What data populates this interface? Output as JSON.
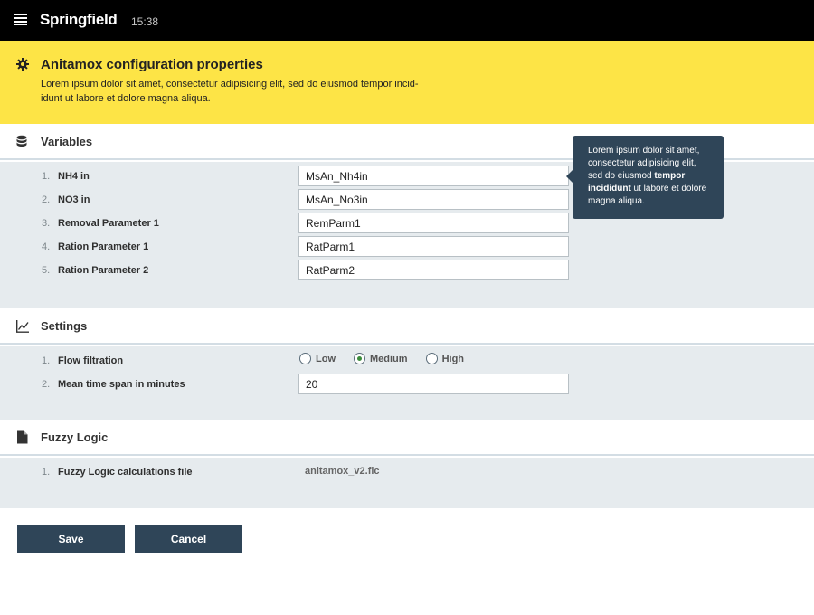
{
  "app": {
    "name": "Springfield",
    "time": "15:38"
  },
  "banner": {
    "title": "Anitamox configuration properties",
    "description": "Lorem ipsum dolor sit amet, consectetur adipisicing elit, sed do eiusmod tempor incid-idunt ut labore et dolore magna aliqua."
  },
  "variables": {
    "title": "Variables",
    "icon": "database-icon",
    "rows": [
      {
        "num": "1.",
        "label": "NH4 in",
        "value": "MsAn_Nh4in"
      },
      {
        "num": "2.",
        "label": "NO3 in",
        "value": "MsAn_No3in"
      },
      {
        "num": "3.",
        "label": "Removal Parameter 1",
        "value": "RemParm1"
      },
      {
        "num": "4.",
        "label": "Ration Parameter 1",
        "value": "RatParm1"
      },
      {
        "num": "5.",
        "label": "Ration Parameter 2",
        "value": "RatParm2"
      }
    ]
  },
  "tooltip": {
    "text_before": "Lorem ipsum dolor sit amet, consectetur adipisicing elit, sed do eiusmod ",
    "text_bold": "tempor incididunt",
    "text_after": " ut labore et dolore magna aliqua."
  },
  "settings": {
    "title": "Settings",
    "icon": "line-chart-icon",
    "flow": {
      "num": "1.",
      "label": "Flow filtration",
      "options": [
        "Low",
        "Medium",
        "High"
      ],
      "selected": "Medium"
    },
    "mean": {
      "num": "2.",
      "label": "Mean time span in minutes",
      "value": "20"
    }
  },
  "fuzzy": {
    "title": "Fuzzy Logic",
    "icon": "document-icon",
    "file": {
      "num": "1.",
      "label": "Fuzzy Logic calculations file",
      "value": "anitamox_v2.flc"
    }
  },
  "actions": {
    "save": "Save",
    "cancel": "Cancel"
  },
  "colors": {
    "topbar": "#000000",
    "banner": "#fde446",
    "panel": "#e6ebee",
    "button": "#2f4558"
  }
}
